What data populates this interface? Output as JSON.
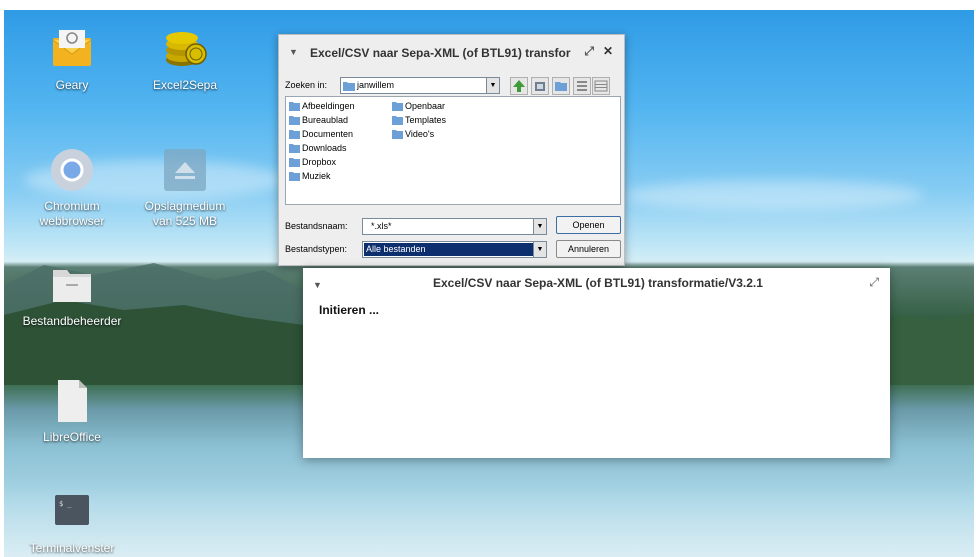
{
  "desktop": {
    "icons": [
      {
        "label": "Geary",
        "icon": "mail-icon"
      },
      {
        "label": "Excel2Sepa",
        "icon": "coins-icon"
      },
      {
        "label": "Chromium\nwebbrowser",
        "icon": "chromium-icon"
      },
      {
        "label": "Opslagmedium\nvan 525 MB",
        "icon": "eject-icon"
      },
      {
        "label": "Bestandbeheerder",
        "icon": "folder-icon"
      },
      {
        "label": "LibreOffice",
        "icon": "document-icon"
      },
      {
        "label": "Terminalvenster",
        "icon": "terminal-icon"
      }
    ]
  },
  "file_dialog": {
    "title": "Excel/CSV naar Sepa-XML (of BTL91) transfor",
    "look_in_label": "Zoeken in:",
    "look_in_value": "janwillem",
    "files_col1": [
      "Afbeeldingen",
      "Bureaublad",
      "Documenten",
      "Downloads",
      "Dropbox",
      "Muziek"
    ],
    "files_col2": [
      "Openbaar",
      "Templates",
      "Video's"
    ],
    "filename_label": "Bestandsnaam:",
    "filename_value": "*.xls*",
    "filetype_label": "Bestandstypen:",
    "filetype_value": "Alle bestanden",
    "open_button": "Openen",
    "cancel_button": "Annuleren"
  },
  "progress_window": {
    "title": "Excel/CSV naar Sepa-XML (of BTL91) transformatie/V3.2.1",
    "status": "Initieren ..."
  },
  "colors": {
    "selection": "#0e2f6d",
    "window_bg": "#eeeeee",
    "desktop_sky": "#53b5f0"
  }
}
